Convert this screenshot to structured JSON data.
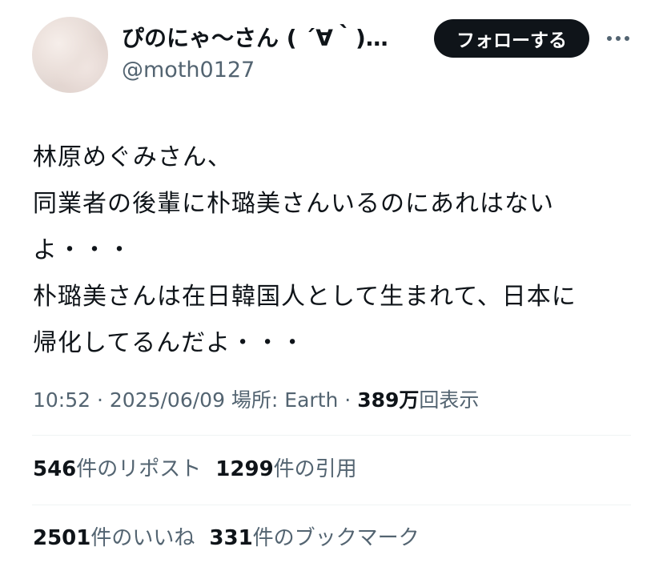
{
  "author": {
    "display_name": "ぴのにゃ〜さん ( ´∀｀)…",
    "handle": "@moth0127"
  },
  "actions": {
    "follow_label": "フォローする"
  },
  "tweet": {
    "lines": [
      "林原めぐみさん、",
      "同業者の後輩に朴璐美さんいるのにあれはない",
      "よ・・・",
      "朴璐美さんは在日韓国人として生まれて、日本に",
      "帰化してるんだよ・・・"
    ]
  },
  "meta": {
    "time": "10:52",
    "sep1": " · ",
    "date": "2025/06/09",
    "location": " 場所: Earth",
    "sep2": " · ",
    "views_count": "389万",
    "views_label": "回表示"
  },
  "stats": {
    "reposts_count": "546",
    "reposts_label": "件のリポスト",
    "quotes_count": "1299",
    "quotes_label": "件の引用",
    "likes_count": "2501",
    "likes_label": "件のいいね",
    "bookmarks_count": "331",
    "bookmarks_label": "件のブックマーク"
  }
}
